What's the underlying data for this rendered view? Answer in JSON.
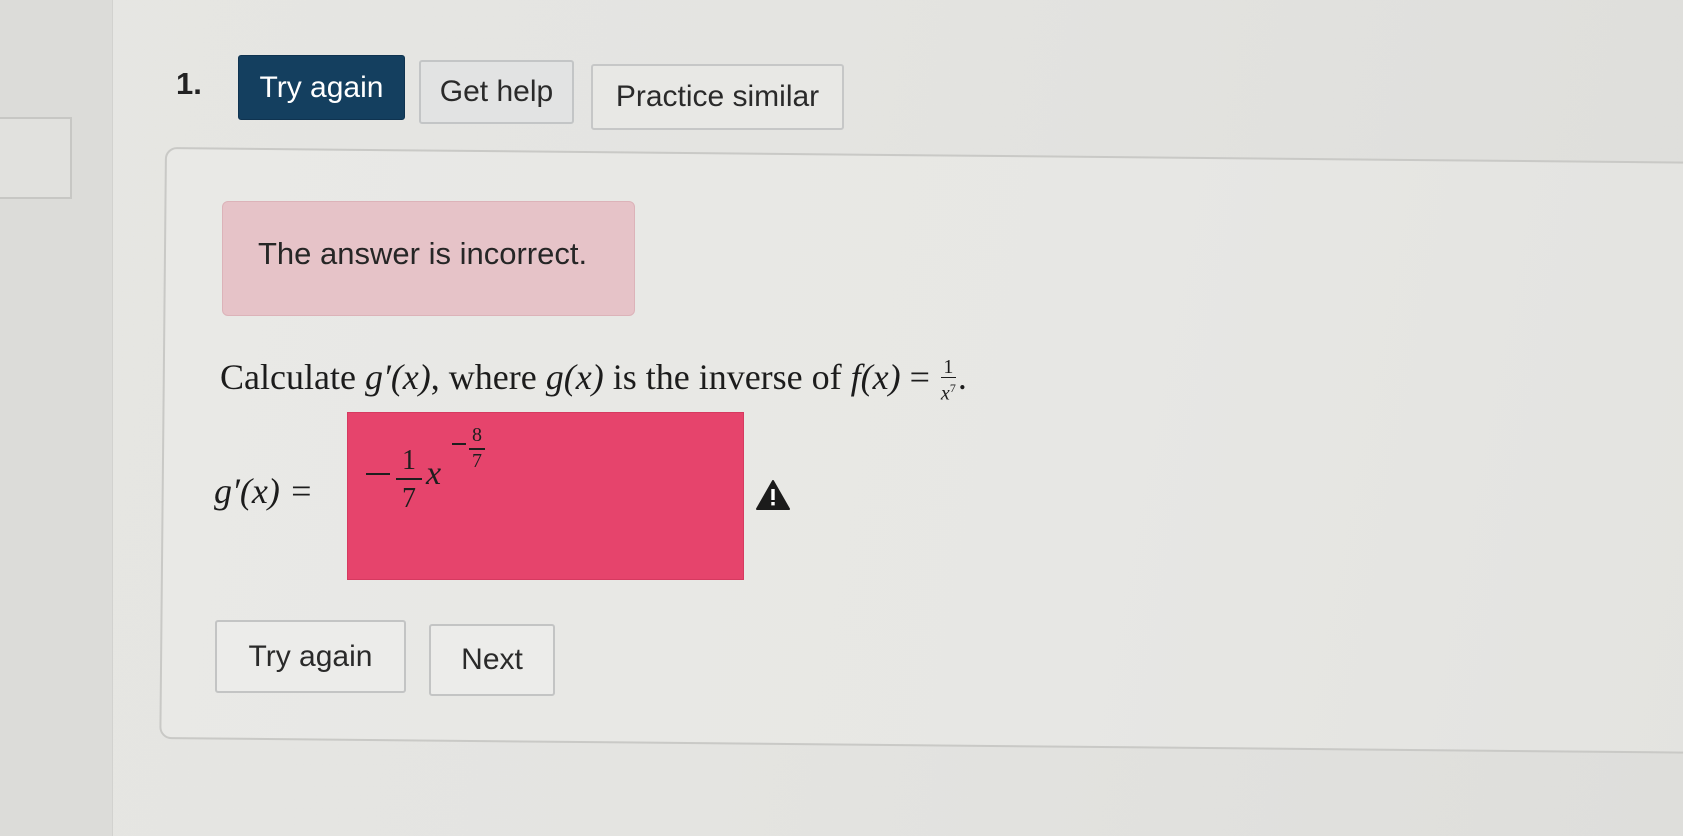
{
  "question": {
    "number": "1.",
    "prompt_prefix": "Calculate",
    "g_prime": "g′(x)",
    "where": ", where",
    "g_of_x": "g(x)",
    "inverse_of": "is the inverse of",
    "f_of_x": "f(x)",
    "equals": "=",
    "f_numerator": "1",
    "f_denominator": "x",
    "f_denominator_exponent": "7",
    "period": "."
  },
  "toolbar": {
    "try_again_label": "Try again",
    "get_help_label": "Get help",
    "practice_similar_label": "Practice similar"
  },
  "feedback": {
    "message": "The answer is incorrect."
  },
  "answer": {
    "label": "g′(x) =",
    "coefficient_numerator": "1",
    "coefficient_denominator": "7",
    "variable": "x",
    "exponent_numerator": "8",
    "exponent_denominator": "7",
    "status_color": "#e6446c",
    "status_icon": "warning-icon"
  },
  "footer": {
    "try_again_label": "Try again",
    "next_label": "Next"
  }
}
